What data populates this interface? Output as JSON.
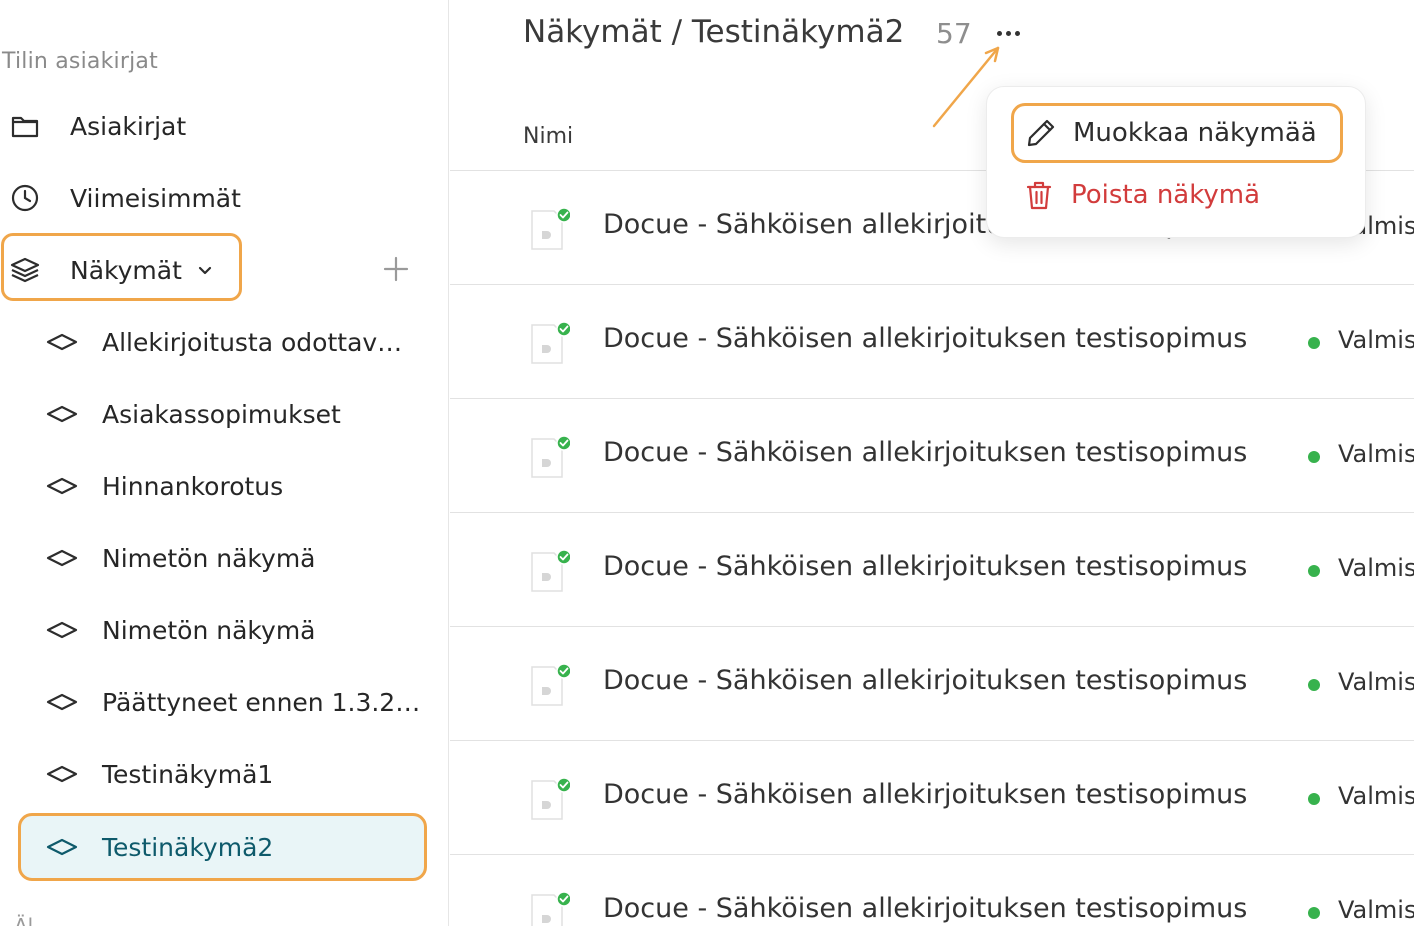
{
  "sidebar": {
    "section_label": "Tilin asiakirjat",
    "documents_label": "Asiakirjat",
    "recent_label": "Viimeisimmät",
    "views_label": "Näkymät",
    "views": [
      {
        "label": "Allekirjoitusta odottav…"
      },
      {
        "label": "Asiakassopimukset"
      },
      {
        "label": "Hinnankorotus"
      },
      {
        "label": "Nimetön näkymä"
      },
      {
        "label": "Nimetön näkymä"
      },
      {
        "label": "Päättyneet ennen 1.3.2…"
      },
      {
        "label": "Testinäkymä1"
      },
      {
        "label": "Testinäkymä2"
      }
    ],
    "cut_off_text": "Äl…"
  },
  "header": {
    "breadcrumb": "Näkymät / Testinäkymä2",
    "count": "57"
  },
  "table": {
    "column_name": "Nimi",
    "rows": [
      {
        "title": "Docue - Sähköisen allekirjoituksen testisopimus",
        "status": "Valmis"
      },
      {
        "title": "Docue - Sähköisen allekirjoituksen testisopimus",
        "status": "Valmis"
      },
      {
        "title": "Docue - Sähköisen allekirjoituksen testisopimus",
        "status": "Valmis"
      },
      {
        "title": "Docue - Sähköisen allekirjoituksen testisopimus",
        "status": "Valmis"
      },
      {
        "title": "Docue - Sähköisen allekirjoituksen testisopimus",
        "status": "Valmis"
      },
      {
        "title": "Docue - Sähköisen allekirjoituksen testisopimus",
        "status": "Valmis"
      },
      {
        "title": "Docue - Sähköisen allekirjoituksen testisopimus",
        "status": "Valmis"
      }
    ]
  },
  "menu": {
    "edit_label": "Muokkaa näkymää",
    "delete_label": "Poista näkymä"
  },
  "colors": {
    "highlight": "#f0a64a",
    "status_green": "#37b24d",
    "danger": "#d23c3c",
    "active_bg": "#e9f5f7",
    "active_text": "#0e5a6b"
  }
}
